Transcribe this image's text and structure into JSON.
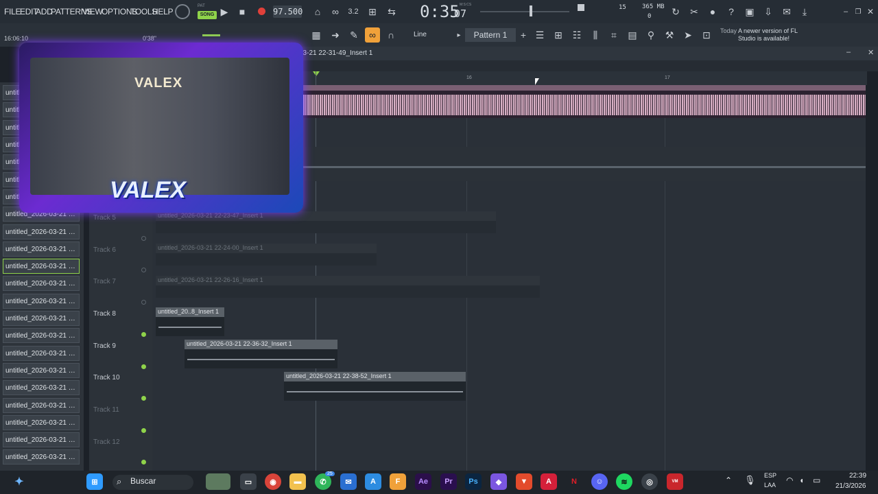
{
  "menu": [
    "FILE",
    "EDIT",
    "ADD",
    "PATTERNS",
    "VIEW",
    "OPTIONS",
    "TOOLS",
    "HELP"
  ],
  "transport": {
    "mode_pat": "PAT",
    "mode_song": "SONG",
    "tempo": "97.500",
    "time_main": "0:35",
    "time_sub": "07",
    "time_unit": "M:S:CS",
    "cpu_value": "15",
    "mem": "365 MB",
    "mem_sub": "0"
  },
  "hint": {
    "time": "16:06:10",
    "duration": "0'38\""
  },
  "snap": {
    "label": "Line",
    "pattern": "Pattern 1"
  },
  "news": {
    "day": "Today",
    "text": "A newer version of FL Studio is available!"
  },
  "playlist": {
    "title": "03-21 22-31-49_Insert 1",
    "ruler": [
      "16",
      "17"
    ]
  },
  "picker_items": [
    "untitled",
    "untitled",
    "untitled",
    "untitled",
    "untitled",
    "untitled",
    "untitled",
    "untitled_2026-03-21 22-...",
    "untitled_2026-03-21 22-...",
    "untitled_2026-03-21 22-...",
    "untitled_2026-03-21 22-...",
    "untitled_2026-03-21 22-...",
    "untitled_2026-03-21 22-...",
    "untitled_2026-03-21 22-...",
    "untitled_2026-03-21 22-...",
    "untitled_2026-03-21 22-...",
    "untitled_2026-03-21 22-...",
    "untitled_2026-03-21 22-...",
    "untitled_2026-03-21 22-...",
    "untitled_2026-03-21 22-...",
    "untitled_2026-03-21 22-...",
    "untitled_2026-03-21 22-..."
  ],
  "tracks": [
    "Track 5",
    "Track 6",
    "Track 7",
    "Track 8",
    "Track 9",
    "Track 10",
    "Track 11",
    "Track 12"
  ],
  "clips": [
    "untitled_2026-03-21 22-23-47_Insert 1",
    "untitled_2026-03-21 22-24-00_Insert 1",
    "untitled_2026-03-21 22-26-16_Insert 1",
    "untitled_20..8_Insert 1",
    "untitled_2026-03-21 22-36-32_Insert 1",
    "untitled_2026-03-21 22-38-52_Insert 1"
  ],
  "overlay": {
    "name_top": "VALEX",
    "name_bottom": "VALEX"
  },
  "taskbar": {
    "search": "Buscar",
    "lang1": "ESP",
    "lang2": "LAA",
    "clock": "22:39",
    "date": "21/3/2026",
    "badge": "25"
  },
  "colors": {
    "accent": "#f0a13a",
    "led": "#8fd34a",
    "record": "#e0403a"
  }
}
